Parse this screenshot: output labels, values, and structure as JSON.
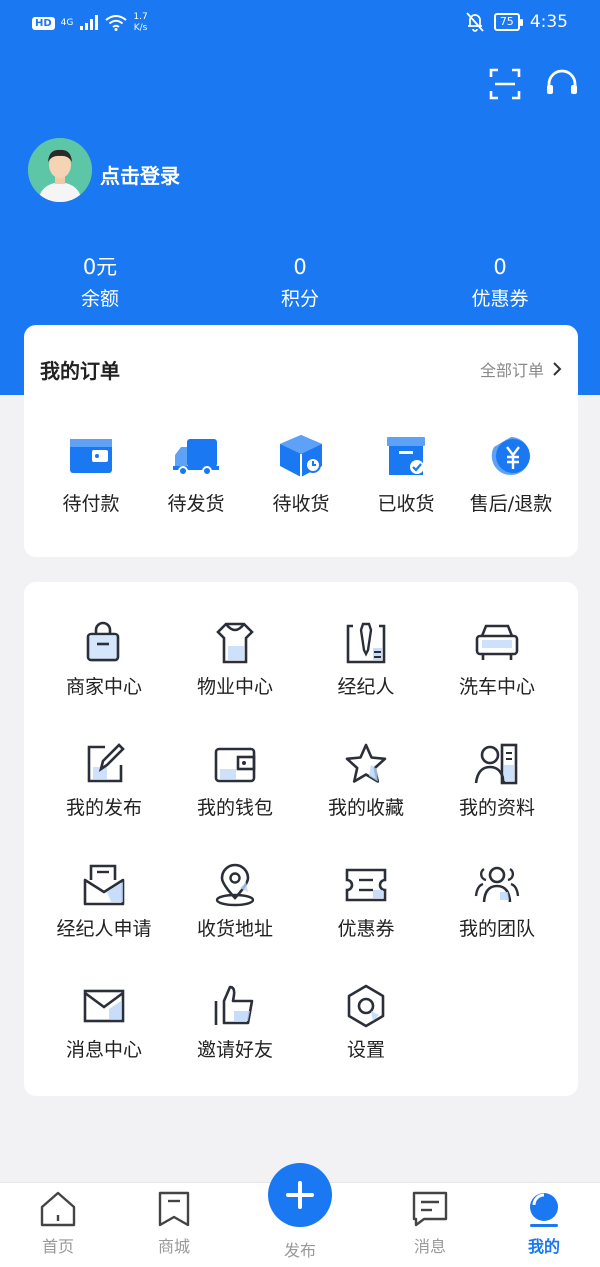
{
  "status_bar": {
    "hd": "HD",
    "network": "4G",
    "speed_value": "1.7",
    "speed_unit": "K/s",
    "battery": "75",
    "time": "4:35"
  },
  "header": {
    "scan_icon": "scan-icon",
    "service_icon": "headset-icon",
    "login_label": "点击登录"
  },
  "stats": [
    {
      "value": "0元",
      "label": "余额"
    },
    {
      "value": "0",
      "label": "积分"
    },
    {
      "value": "0",
      "label": "优惠券"
    }
  ],
  "orders": {
    "title": "我的订单",
    "all_label": "全部订单",
    "items": [
      {
        "label": "待付款",
        "icon": "wallet-icon"
      },
      {
        "label": "待发货",
        "icon": "truck-icon"
      },
      {
        "label": "待收货",
        "icon": "package-icon"
      },
      {
        "label": "已收货",
        "icon": "received-box-icon"
      },
      {
        "label": "售后/退款",
        "icon": "refund-icon"
      }
    ]
  },
  "services": [
    {
      "label": "商家中心",
      "icon": "shopping-bag-icon"
    },
    {
      "label": "物业中心",
      "icon": "uniform-icon"
    },
    {
      "label": "经纪人",
      "icon": "tie-icon"
    },
    {
      "label": "洗车中心",
      "icon": "car-icon"
    },
    {
      "label": "我的发布",
      "icon": "edit-icon"
    },
    {
      "label": "我的钱包",
      "icon": "wallet-icon"
    },
    {
      "label": "我的收藏",
      "icon": "star-icon"
    },
    {
      "label": "我的资料",
      "icon": "profile-icon"
    },
    {
      "label": "经纪人申请",
      "icon": "application-icon"
    },
    {
      "label": "收货地址",
      "icon": "location-icon"
    },
    {
      "label": "优惠券",
      "icon": "coupon-icon"
    },
    {
      "label": "我的团队",
      "icon": "team-icon"
    },
    {
      "label": "消息中心",
      "icon": "mail-icon"
    },
    {
      "label": "邀请好友",
      "icon": "thumbs-up-icon"
    },
    {
      "label": "设置",
      "icon": "settings-icon"
    }
  ],
  "tabbar": {
    "items": [
      {
        "label": "首页",
        "icon": "home-icon"
      },
      {
        "label": "商城",
        "icon": "bookmark-icon"
      },
      {
        "label": "发布",
        "icon": "plus-icon"
      },
      {
        "label": "消息",
        "icon": "message-icon"
      },
      {
        "label": "我的",
        "icon": "profile-dot-icon"
      }
    ],
    "active_index": 4
  },
  "colors": {
    "primary": "#1a78f2",
    "icon_stroke": "#2b2f3a",
    "icon_accent": "#9cc2f5"
  }
}
